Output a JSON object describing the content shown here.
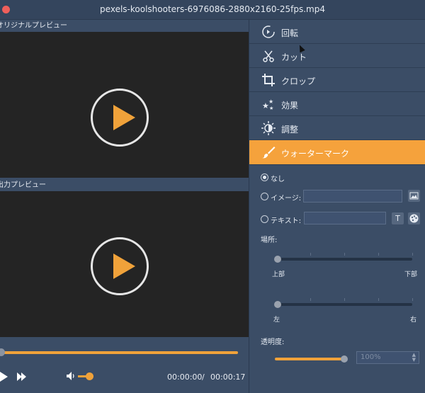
{
  "window": {
    "title": "pexels-koolshooters-6976086-2880x2160-25fps.mp4"
  },
  "preview": {
    "original_label": "オリジナルプレビュー",
    "output_label": "出力プレビュー"
  },
  "playback": {
    "current_time": "00:00:00",
    "separator": "/",
    "total_time": "00:00:17",
    "progress": 0.0,
    "volume": 0.4
  },
  "menu": {
    "items": [
      {
        "label": "回転",
        "icon": "rotate-icon"
      },
      {
        "label": "カット",
        "icon": "scissors-icon"
      },
      {
        "label": "クロップ",
        "icon": "crop-icon"
      },
      {
        "label": "効果",
        "icon": "effects-icon"
      },
      {
        "label": "調整",
        "icon": "adjust-icon"
      },
      {
        "label": "ウォーターマーク",
        "icon": "brush-icon",
        "active": true
      }
    ]
  },
  "watermark": {
    "none_label": "なし",
    "image_label": "イメージ:",
    "image_value": "",
    "text_label": "テキスト:",
    "text_value": "",
    "text_btn": "T",
    "position_label": "場所:",
    "vertical_min": "上部",
    "vertical_max": "下部",
    "horizontal_min": "左",
    "horizontal_max": "右",
    "opacity_label": "透明度:",
    "opacity_value": "100%",
    "selected": "none"
  },
  "colors": {
    "accent": "#f5a23c",
    "panel": "#3b4d66",
    "video_bg": "#242424"
  }
}
